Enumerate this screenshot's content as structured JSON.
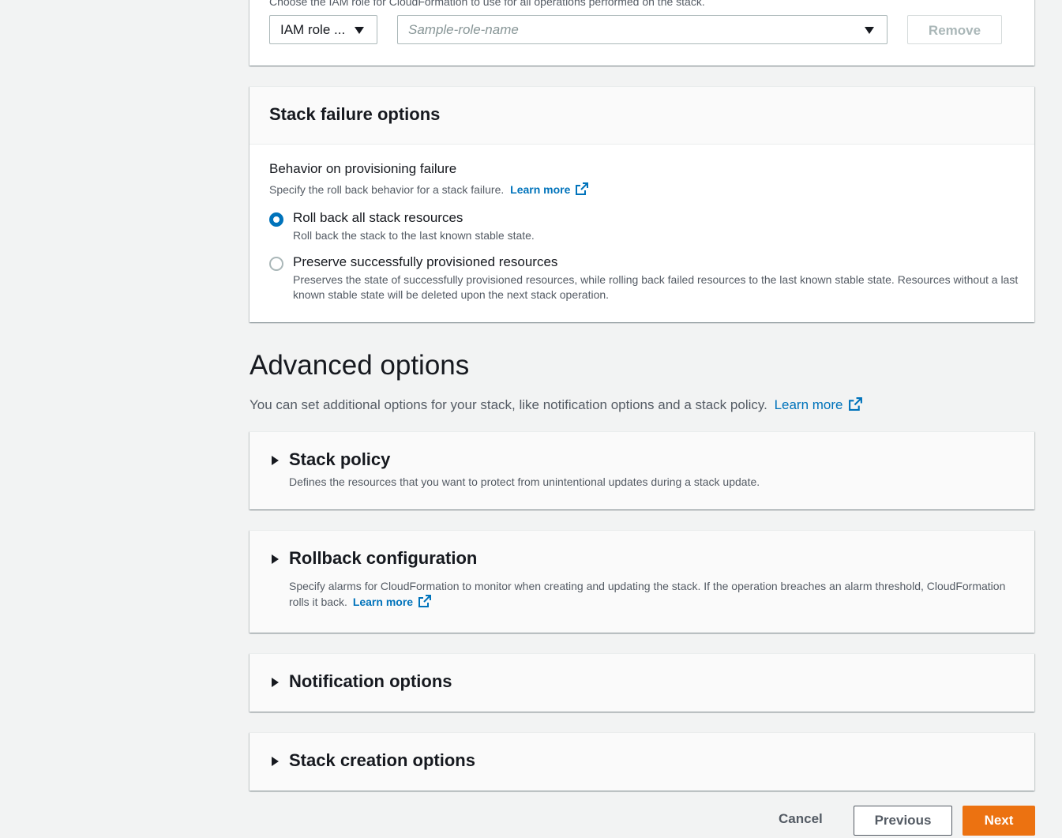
{
  "permissions": {
    "description": "Choose the IAM role for CloudFormation to use for all operations performed on the stack.",
    "iam_type_value": "IAM role ...",
    "role_placeholder": "Sample-role-name",
    "remove_label": "Remove"
  },
  "failure": {
    "title": "Stack failure options",
    "behavior_label": "Behavior on provisioning failure",
    "behavior_desc": "Specify the roll back behavior for a stack failure.",
    "learn_more": "Learn more",
    "options": [
      {
        "label": "Roll back all stack resources",
        "desc": "Roll back the stack to the last known stable state.",
        "selected": true
      },
      {
        "label": "Preserve successfully provisioned resources",
        "desc": "Preserves the state of successfully provisioned resources, while rolling back failed resources to the last known stable state. Resources without a last known stable state will be deleted upon the next stack operation.",
        "selected": false
      }
    ]
  },
  "advanced": {
    "title": "Advanced options",
    "desc": "You can set additional options for your stack, like notification options and a stack policy.",
    "learn_more": "Learn more",
    "sections": [
      {
        "title": "Stack policy",
        "desc": "Defines the resources that you want to protect from unintentional updates during a stack update."
      },
      {
        "title": "Rollback configuration",
        "desc": "Specify alarms for CloudFormation to monitor when creating and updating the stack. If the operation breaches an alarm threshold, CloudFormation rolls it back.",
        "learn_more": "Learn more"
      },
      {
        "title": "Notification options"
      },
      {
        "title": "Stack creation options"
      }
    ]
  },
  "footer": {
    "cancel": "Cancel",
    "previous": "Previous",
    "next": "Next"
  },
  "colors": {
    "accent": "#0073bb",
    "primary_button": "#ec7211",
    "background": "#f2f3f3"
  }
}
